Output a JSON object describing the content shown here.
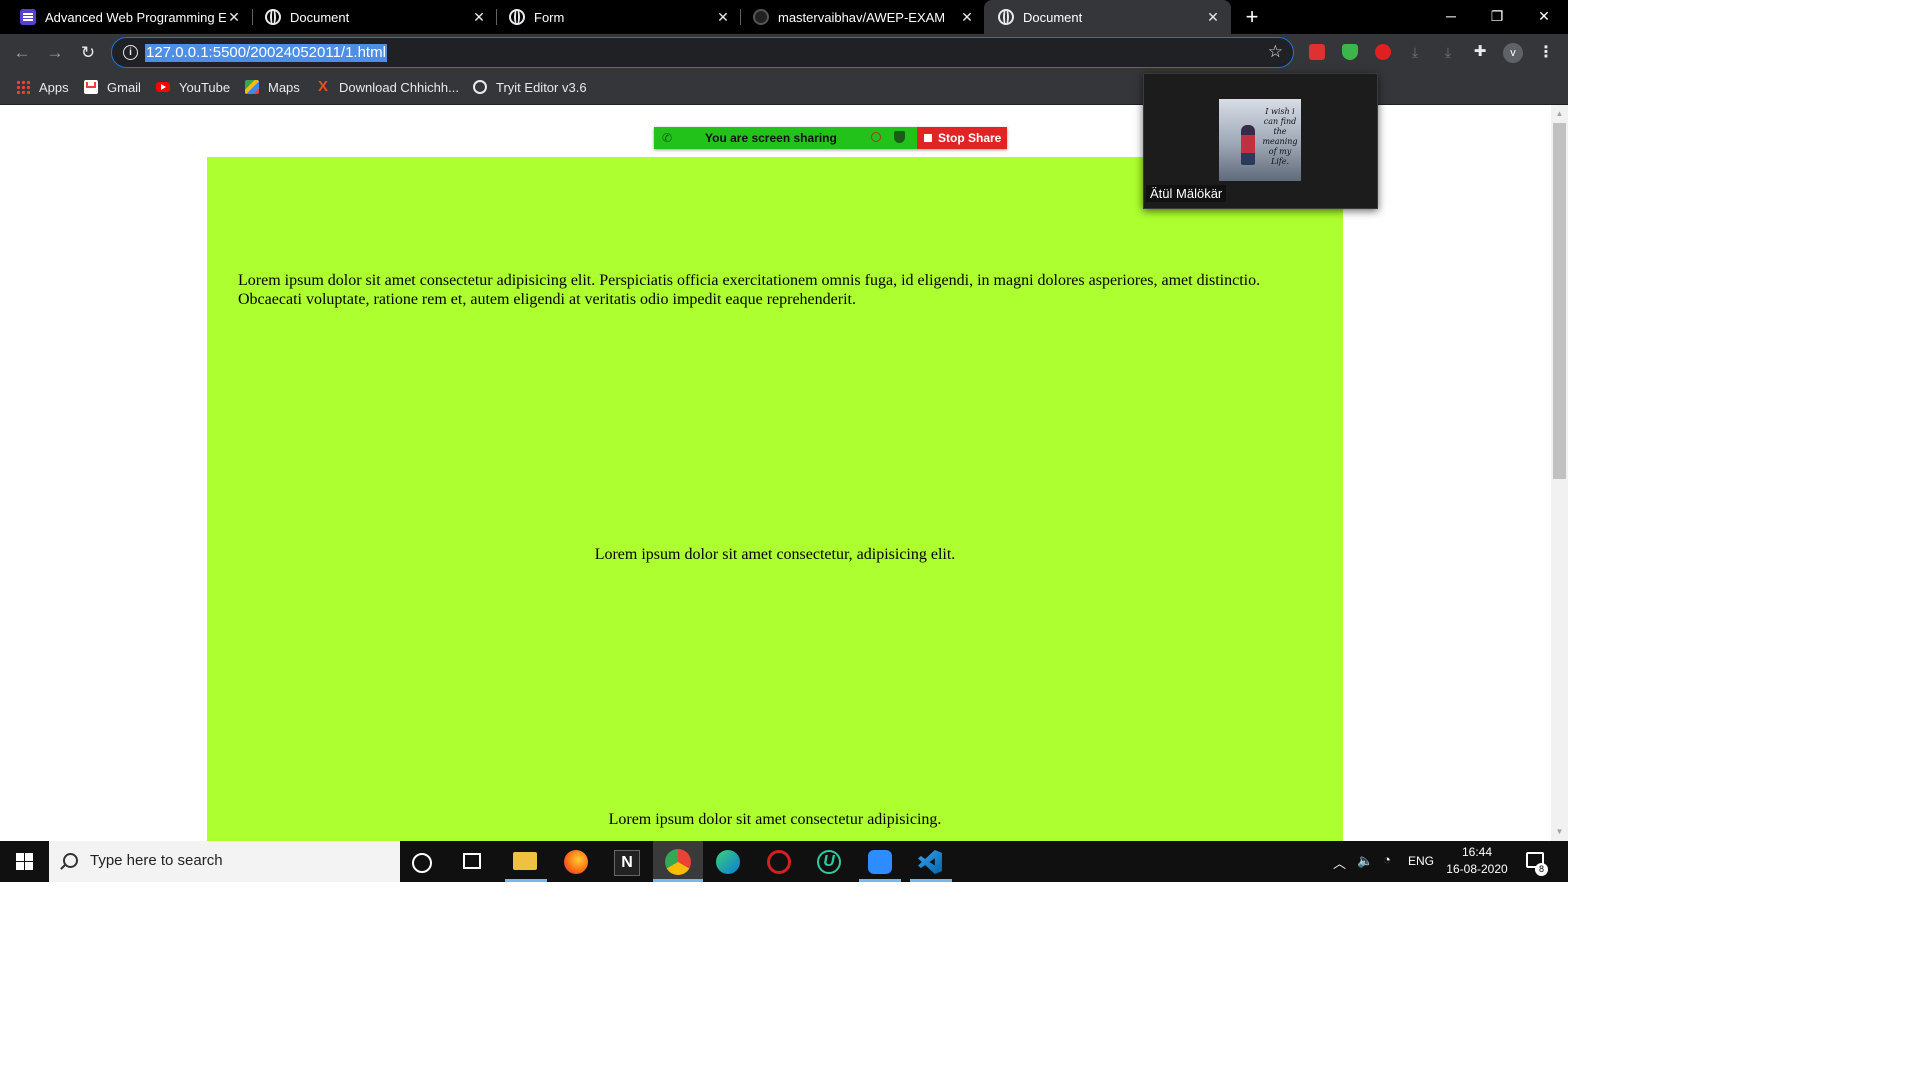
{
  "tabs": [
    {
      "title": "Advanced Web Programming En",
      "icon": "document-list-icon"
    },
    {
      "title": "Document",
      "icon": "globe-icon"
    },
    {
      "title": "Form",
      "icon": "globe-icon"
    },
    {
      "title": "mastervaibhav/AWEP-EXAM",
      "icon": "github-icon"
    },
    {
      "title": "Document",
      "icon": "globe-icon",
      "active": true
    }
  ],
  "window_controls": {
    "minimize": "─",
    "restore": "❐",
    "close": "✕"
  },
  "address_bar": {
    "url": "127.0.0.1:5500/20024052011/1.html"
  },
  "profile": {
    "initial": "v"
  },
  "bookmarks": [
    {
      "label": "Apps",
      "icon": "apps-grid-icon"
    },
    {
      "label": "Gmail",
      "icon": "gmail-icon"
    },
    {
      "label": "YouTube",
      "icon": "youtube-icon"
    },
    {
      "label": "Maps",
      "icon": "maps-icon"
    },
    {
      "label": "Download Chhichh...",
      "icon": "x-logo-icon"
    },
    {
      "label": "Tryit Editor v3.6",
      "icon": "globe-icon"
    }
  ],
  "page": {
    "background_color": "#adff2f",
    "paragraph_1": "Lorem ipsum dolor sit amet consectetur adipisicing elit. Perspiciatis officia exercitationem omnis fuga, id eligendi, in magni dolores asperiores, amet distinctio. Obcaecati voluptate, ratione rem et, autem eligendi at veritatis odio impedit eaque reprehenderit.",
    "paragraph_2": "Lorem ipsum dolor sit amet consectetur, adipisicing elit.",
    "paragraph_3": "Lorem ipsum dolor sit amet consectetur adipisicing."
  },
  "screen_share": {
    "status": "You are screen sharing",
    "stop_label": "Stop Share"
  },
  "video": {
    "participant_name": "Ätül Mälökär",
    "image_text": "I wish i can find the meaning of my Life."
  },
  "taskbar": {
    "search_placeholder": "Type here to search",
    "language": "ENG",
    "time": "16:44",
    "date": "16-08-2020",
    "notification_count": "8"
  }
}
